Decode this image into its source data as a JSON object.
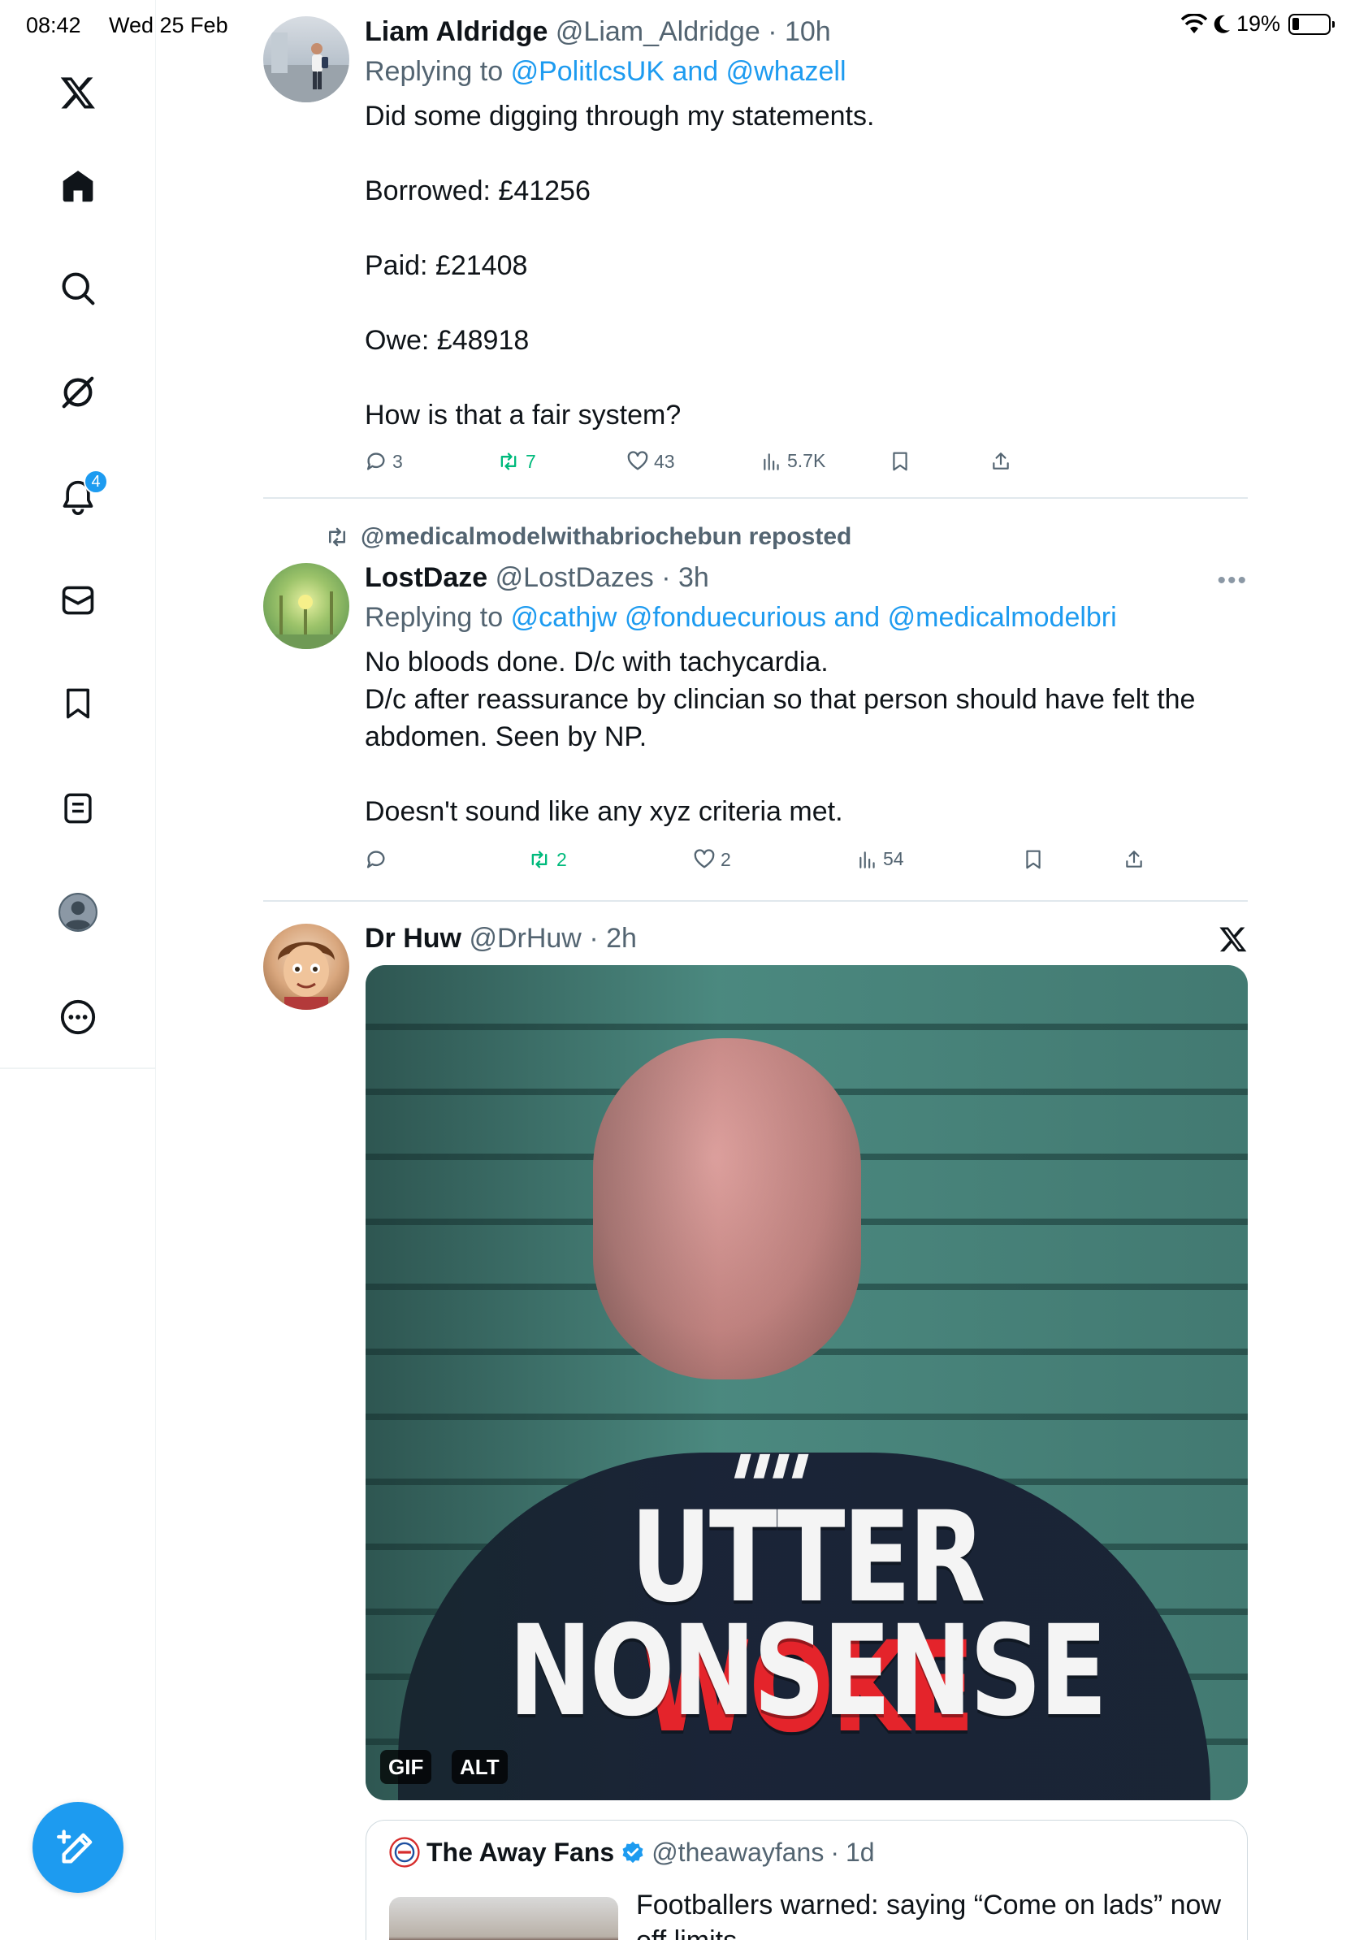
{
  "status_bar": {
    "time": "08:42",
    "date": "Wed 25 Feb",
    "battery": "19%"
  },
  "sidebar": {
    "items": [
      {
        "name": "home",
        "icon": "home-icon"
      },
      {
        "name": "explore",
        "icon": "search-icon"
      },
      {
        "name": "grok",
        "icon": "grok-icon"
      },
      {
        "name": "notifications",
        "icon": "bell-icon",
        "badge": "4"
      },
      {
        "name": "messages",
        "icon": "mail-icon"
      },
      {
        "name": "bookmarks",
        "icon": "bookmark-icon"
      },
      {
        "name": "lists",
        "icon": "list-icon"
      },
      {
        "name": "profile",
        "icon": "profile-icon"
      },
      {
        "name": "more",
        "icon": "more-icon"
      }
    ]
  },
  "tweets": [
    {
      "name": "Liam Aldridge",
      "handle": "@Liam_Aldridge",
      "time": "10h",
      "replying_prefix": "Replying to",
      "replying_to": "@PolitlcsUK and @whazell",
      "text": "Did some digging through my statements.\n\nBorrowed: £41256\n\nPaid: £21408\n\nOwe: £48918\n\nHow is that a fair system?",
      "replies": "3",
      "reposts": "7",
      "likes": "43",
      "views": "5.7K"
    },
    {
      "repost_label": "@medicalmodelwithabriochebun reposted",
      "name": "LostDaze",
      "handle": "@LostDazes",
      "time": "3h",
      "replying_prefix": "Replying to",
      "replying_to": "@cathjw @fonduecurious and @medicalmodelbri",
      "text": "No bloods done. D/c with tachycardia.\nD/c after reassurance by clincian so that person should have felt the abdomen. Seen by NP.\n\nDoesn't sound like any xyz criteria met.",
      "replies": "",
      "reposts": "2",
      "likes": "2",
      "views": "54"
    },
    {
      "name": "Dr Huw",
      "handle": "@DrHuw",
      "time": "2h",
      "media": {
        "caption_line1_a": "UTTER",
        "caption_line1_b": "WOKE",
        "caption_line2": "NONSENSE",
        "quote_marks": "\"\"",
        "tag_gif": "GIF",
        "tag_alt": "ALT"
      },
      "quote": {
        "name": "The Away Fans",
        "handle": "@theawayfans",
        "time": "1d",
        "text": "Footballers warned: saying “Come on lads” now off limits"
      }
    }
  ],
  "colors": {
    "accent": "#1d9bf0",
    "repost_green": "#00ba7c",
    "muted": "#536471"
  }
}
